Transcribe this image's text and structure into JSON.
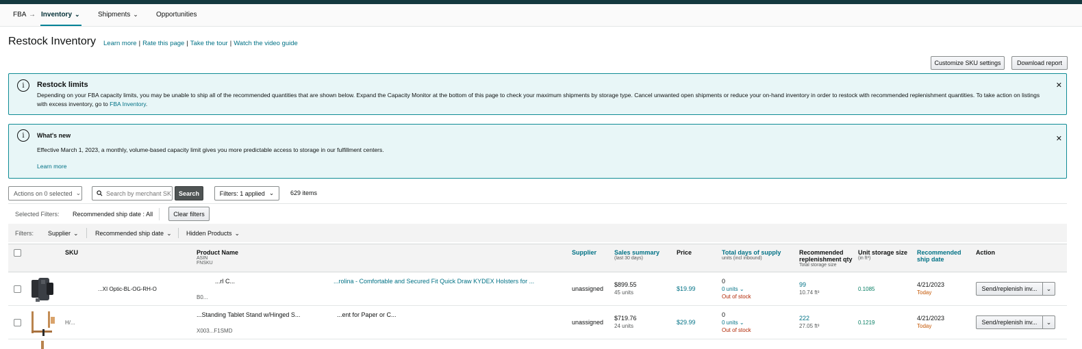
{
  "nav": {
    "fba": "FBA",
    "arrow": "→",
    "inventory": "Inventory",
    "shipments": "Shipments",
    "opportunities": "Opportunities"
  },
  "page": {
    "title": "Restock Inventory",
    "links": [
      "Learn more",
      "Rate this page",
      "Take the tour",
      "Watch the video guide"
    ],
    "customize_btn": "Customize SKU settings",
    "download_btn": "Download report"
  },
  "alert1": {
    "title": "Restock limits",
    "body": "Depending on your FBA capacity limits, you may be unable to ship all of the recommended quantities that are shown below. Expand the Capacity Monitor at the bottom of this page to check your maximum shipments by storage type. Cancel unwanted open shipments or reduce your on-hand inventory in order to restock with recommended replenishment quantities. To take action on listings",
    "body2": "with excess inventory, go to",
    "link": "FBA Inventory",
    "period": "."
  },
  "alert2": {
    "title": "What's new",
    "body": "Effective March 1, 2023, a monthly, volume-based capacity limit gives you more predictable access to storage in our fulfillment centers.",
    "link": "Learn more"
  },
  "toolbar": {
    "actions": "Actions on 0 selected",
    "search_placeholder": "Search by merchant SKU",
    "search_btn": "Search",
    "filters": "Filters: 1 applied",
    "count": "629 items"
  },
  "selected_filters": {
    "label": "Selected Filters:",
    "value": "Recommended ship date : All",
    "clear": "Clear filters"
  },
  "filters": {
    "label": "Filters:",
    "items": [
      "Supplier",
      "Recommended ship date",
      "Hidden Products"
    ]
  },
  "columns": {
    "sku": "SKU",
    "product": "Product Name",
    "asin": "ASIN",
    "fnsku": "FNSKU",
    "supplier": "Supplier",
    "sales": "Sales summary",
    "sales_sub": "(last 30 days)",
    "price": "Price",
    "supply": "Total days of supply",
    "supply_sub": "units (incl inbound)",
    "rec_qty": "Recommended replenishment qty",
    "rec_qty_sub": "Total storage size",
    "unit_size": "Unit storage size",
    "unit_size_sub": "(in ft³)",
    "ship_date": "Recommended ship date",
    "action": "Action"
  },
  "rows": [
    {
      "sku": "...XI Optic-BL-OG-RH-O",
      "product_a": "...rl C...",
      "product_b": "...rolina - Comfortable and Secured Fit Quick Draw KYDEX Holsters for ...",
      "asin": "B0...",
      "supplier": "unassigned",
      "sales": "$899.55",
      "sales_units": "45 units",
      "price": "$19.99",
      "days": "0",
      "units": "0 units",
      "stock": "Out of stock",
      "rec_qty": "99",
      "rec_size": "10.74 ft³",
      "unit_size": "0.1085",
      "ship_date": "4/21/2023",
      "ship_when": "Today",
      "action": "Send/replenish inv...",
      "thumb": "holster"
    },
    {
      "sku": "H/...",
      "product_a": "...Standing Tablet Stand w/Hinged S...",
      "product_b": "...ent for Paper or C...",
      "asin": "X003...F1SMD",
      "supplier": "unassigned",
      "sales": "$719.76",
      "sales_units": "24 units",
      "price": "$29.99",
      "days": "0",
      "units": "0 units",
      "stock": "Out of stock",
      "rec_qty": "222",
      "rec_size": "27.05 ft³",
      "unit_size": "0.1219",
      "ship_date": "4/21/2023",
      "ship_when": "Today",
      "action": "Send/replenish inv...",
      "thumb": "stand"
    }
  ],
  "colors": {
    "teal": "#007185",
    "alert_border": "#0e8b94",
    "alert_bg": "#e8f6f7",
    "red": "#b12704",
    "orange": "#c45500"
  }
}
